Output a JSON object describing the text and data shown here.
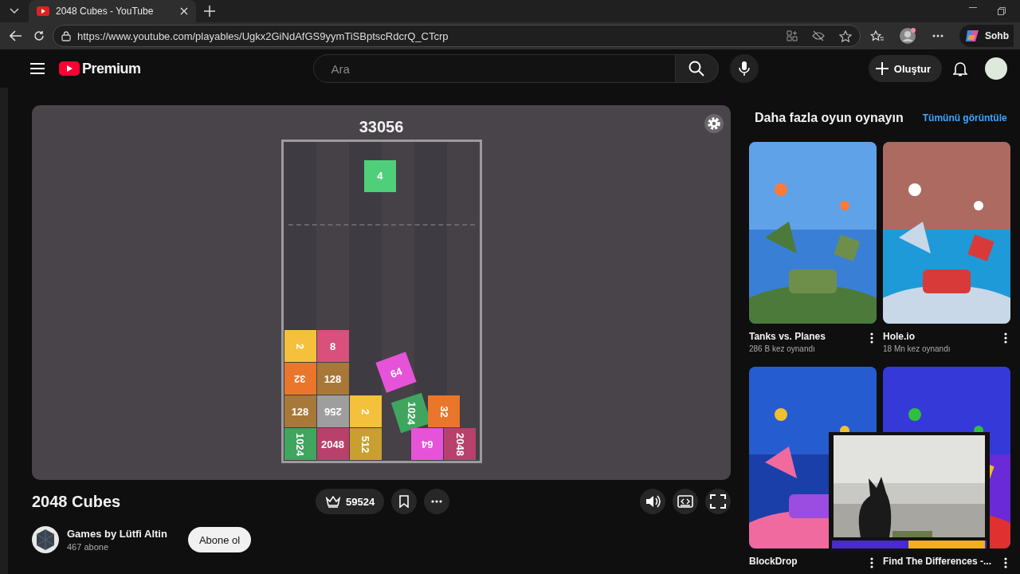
{
  "browser": {
    "tab_title": "2048 Cubes - YouTube",
    "url": "https://www.youtube.com/playables/Ugkx2GiNdAfGS9yymTiSBptscRdcrQ_CTcrp",
    "side_button": "Sohb"
  },
  "header": {
    "logo": "Premium",
    "search": {
      "placeholder": "Ara"
    },
    "create_button": "Oluştur"
  },
  "game": {
    "score": "33056",
    "current": {
      "value": "4",
      "color": "#4fcf7a"
    },
    "cubes": [
      {
        "value": "2",
        "color": "#f5c03c"
      },
      {
        "value": "8",
        "color": "#d9507c"
      },
      {
        "value": "32",
        "color": "#e9762b"
      },
      {
        "value": "128",
        "color": "#a87838"
      },
      {
        "value": "64",
        "color": "#e653d8"
      },
      {
        "value": "128",
        "color": "#a87838"
      },
      {
        "value": "256",
        "color": "#9e9e9e"
      },
      {
        "value": "2",
        "color": "#f5c03c"
      },
      {
        "value": "1024",
        "color": "#3fa55f"
      },
      {
        "value": "32",
        "color": "#e9762b"
      },
      {
        "value": "1024",
        "color": "#3fa55f"
      },
      {
        "value": "2048",
        "color": "#b8416b"
      },
      {
        "value": "512",
        "color": "#c9a030"
      },
      {
        "value": "64",
        "color": "#e653d8"
      },
      {
        "value": "2048",
        "color": "#b8416b"
      }
    ]
  },
  "title": "2048 Cubes",
  "likes": "59524",
  "channel": {
    "name": "Games by Lütfi Altin",
    "subscribers": "467 abone",
    "subscribe_button": "Abone ol"
  },
  "more_games": {
    "title": "Daha fazla oyun oynayın",
    "view_all": "Tümünü görüntüle",
    "items": [
      {
        "title": "Tanks vs. Planes",
        "plays": "286 B kez oynandı",
        "kind": "picture"
      },
      {
        "title": "Hole.io",
        "plays": "18 Mn kez oynandı",
        "kind": "picture"
      },
      {
        "title": "BlockDrop",
        "kind": "picture"
      },
      {
        "title": "Find The Differences -...",
        "kind": "picture"
      }
    ]
  }
}
